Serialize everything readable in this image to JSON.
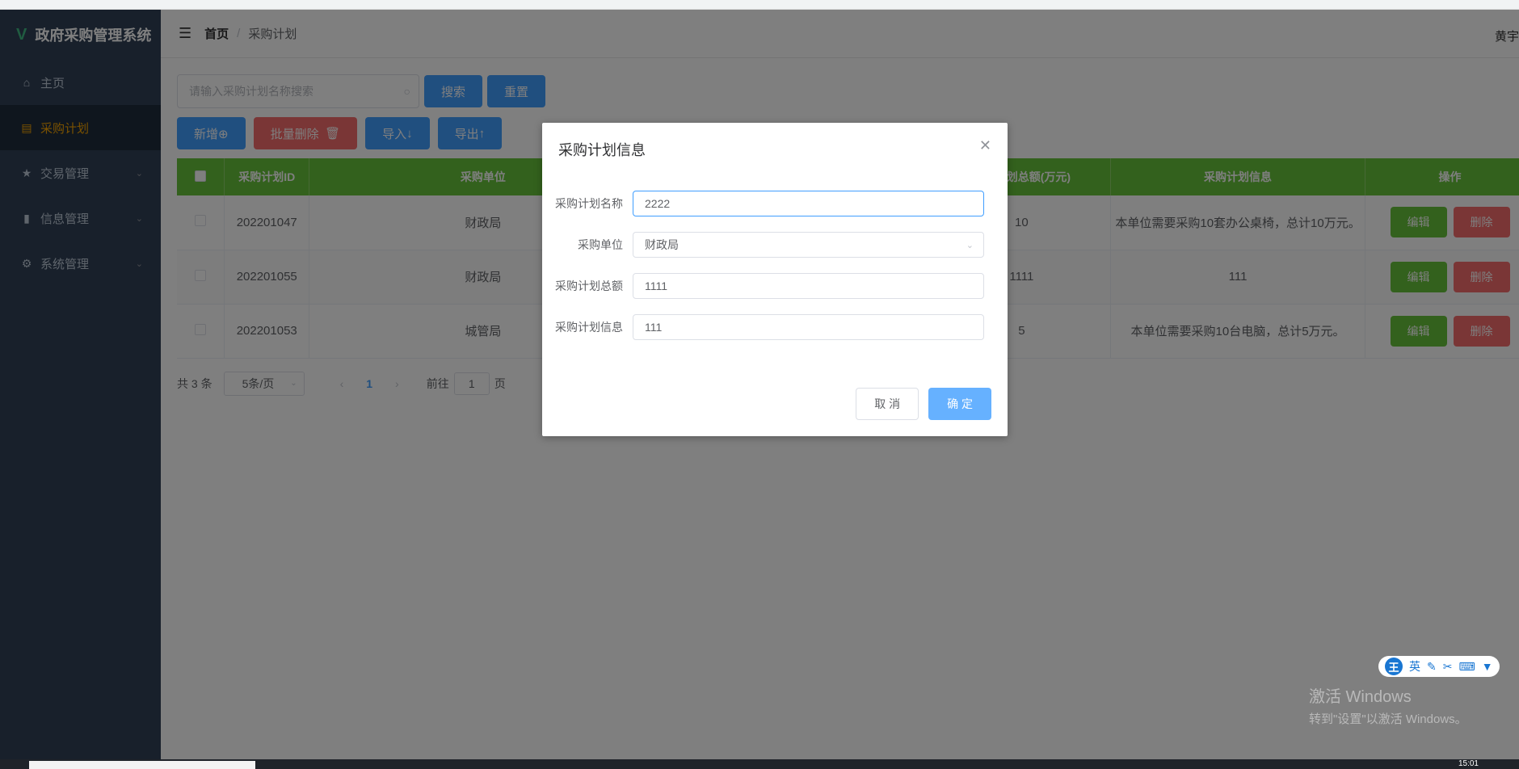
{
  "app": {
    "title": "政府采购管理系统",
    "user": "黄宇"
  },
  "sidebar": {
    "items": [
      {
        "label": "主页",
        "icon": "home-icon"
      },
      {
        "label": "采购计划",
        "icon": "document-icon"
      },
      {
        "label": "交易管理",
        "icon": "star-icon"
      },
      {
        "label": "信息管理",
        "icon": "bar-chart-icon"
      },
      {
        "label": "系统管理",
        "icon": "gear-icon"
      }
    ]
  },
  "breadcrumb": {
    "home": "首页",
    "current": "采购计划"
  },
  "search": {
    "placeholder": "请输入采购计划名称搜索",
    "search_label": "搜索",
    "reset_label": "重置"
  },
  "toolbar": {
    "add_label": "新增⊕",
    "batch_delete_label": "批量删除",
    "import_label": "导入",
    "export_label": "导出"
  },
  "table": {
    "headers": [
      "采购计划ID",
      "采购单位",
      "采购计划总额(万元)",
      "采购计划信息",
      "操作"
    ],
    "rows": [
      {
        "id": "202201047",
        "unit": "财政局",
        "total": "10",
        "info": "本单位需要采购10套办公桌椅，总计10万元。"
      },
      {
        "id": "202201055",
        "unit": "财政局",
        "total": "1111",
        "info": "111"
      },
      {
        "id": "202201053",
        "unit": "城管局",
        "total": "5",
        "info": "本单位需要采购10台电脑，总计5万元。"
      }
    ],
    "edit_label": "编辑",
    "delete_label": "删除"
  },
  "pagination": {
    "total": "共 3 条",
    "page_size": "5条/页",
    "current": "1",
    "goto_prefix": "前往",
    "goto_value": "1",
    "goto_suffix": "页"
  },
  "dialog": {
    "title": "采购计划信息",
    "fields": [
      {
        "label": "采购计划名称",
        "value": "2222"
      },
      {
        "label": "采购单位",
        "value": "财政局"
      },
      {
        "label": "采购计划总额",
        "value": "1111"
      },
      {
        "label": "采购计划信息",
        "value": "111"
      }
    ],
    "cancel_label": "取 消",
    "confirm_label": "确 定"
  },
  "ime": {
    "logo": "王",
    "mode": "英"
  },
  "watermark": {
    "line1": "激活 Windows",
    "line2": "转到\"设置\"以激活 Windows。"
  },
  "taskbar": {
    "time": "15:01"
  },
  "colors": {
    "sidebar_bg": "#304156",
    "active_menu": "#f4a300",
    "primary": "#409eff",
    "success": "#67c23a",
    "danger": "#f56c6c"
  }
}
